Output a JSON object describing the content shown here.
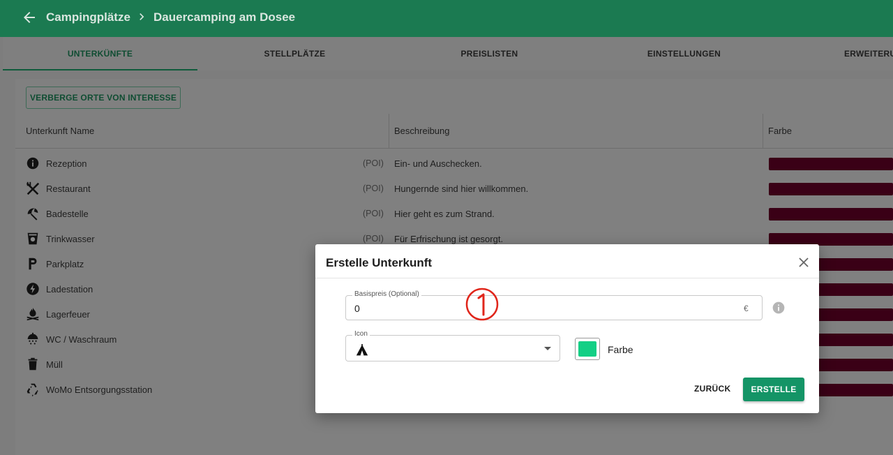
{
  "appbar": {
    "breadcrumb_parent": "Campingplätze",
    "breadcrumb_current": "Dauercamping am Dosee"
  },
  "tabs": [
    {
      "label": "UNTERKÜNFTE",
      "active": true
    },
    {
      "label": "STELLPLÄTZE",
      "active": false
    },
    {
      "label": "PREISLISTEN",
      "active": false
    },
    {
      "label": "EINSTELLUNGEN",
      "active": false
    },
    {
      "label": "ERWEITERUNGEN",
      "active": false
    }
  ],
  "toolbar": {
    "hide_poi_label": "VERBERGE ORTE VON INTERESSE"
  },
  "table": {
    "headers": {
      "name": "Unterkunft Name",
      "description": "Beschreibung",
      "color": "Farbe"
    },
    "row_color": "#3a0016",
    "rows": [
      {
        "icon": "info-icon",
        "name": "Rezeption",
        "tag": "(POI)",
        "description": "Ein- und Auschecken."
      },
      {
        "icon": "restaurant-icon",
        "name": "Restaurant",
        "tag": "(POI)",
        "description": "Hungernde sind hier willkommen."
      },
      {
        "icon": "beach-umbrella-icon",
        "name": "Badestelle",
        "tag": "(POI)",
        "description": "Hier geht es zum Strand."
      },
      {
        "icon": "drinking-water-icon",
        "name": "Trinkwasser",
        "tag": "(POI)",
        "description": "Für Erfrischung ist gesorgt."
      },
      {
        "icon": "parking-icon",
        "name": "Parkplatz",
        "tag": "",
        "description": ""
      },
      {
        "icon": "charging-station-icon",
        "name": "Ladestation",
        "tag": "",
        "description": ""
      },
      {
        "icon": "campfire-icon",
        "name": "Lagerfeuer",
        "tag": "",
        "description": ""
      },
      {
        "icon": "shower-icon",
        "name": "WC / Waschraum",
        "tag": "",
        "description": ""
      },
      {
        "icon": "trash-icon",
        "name": "Müll",
        "tag": "",
        "description": ""
      },
      {
        "icon": "recycle-icon",
        "name": "WoMo Entsorgungsstation",
        "tag": "",
        "description": ""
      }
    ]
  },
  "dialog": {
    "title": "Erstelle Unterkunft",
    "price": {
      "label": "Basispreis (Optional)",
      "value": "0",
      "currency": "€"
    },
    "icon_select": {
      "label": "Icon",
      "selected_icon": "tent-icon"
    },
    "color": {
      "label": "Farbe",
      "value": "#14cf85"
    },
    "back_label": "ZURÜCK",
    "create_label": "ERSTELLE"
  },
  "annotation": {
    "step": "1",
    "color": "#e0261b"
  }
}
